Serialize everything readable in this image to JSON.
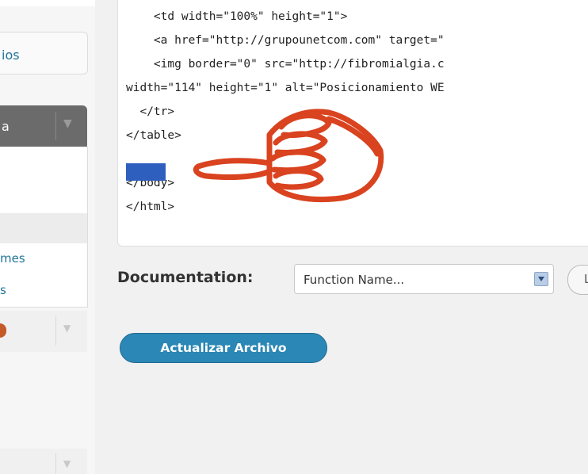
{
  "sidebar": {
    "top_item_fragment": "ios",
    "active_menu_fragment": "a",
    "submenu_items": [
      "mes",
      "s"
    ]
  },
  "editor": {
    "code_lines": [
      "    <td width=\"100%\" height=\"1\">",
      "    <a href=\"http://grupounetcom.com\" target=\"",
      "    <img border=\"0\" src=\"http://fibromialgia.c",
      "width=\"114\" height=\"1\" alt=\"Posicionamiento WE",
      "  </tr>",
      "</table>",
      "",
      "</body>",
      "</html>"
    ]
  },
  "documentation": {
    "label": "Documentation:",
    "select_value": "Function Name...",
    "lookup_fragment": "L"
  },
  "update_button": {
    "label": "Actualizar Archivo"
  },
  "colors": {
    "link_blue": "#21759b",
    "button_blue": "#2b87b5",
    "selection_blue": "#2f5fbe",
    "hand_stroke": "#d9431f"
  }
}
